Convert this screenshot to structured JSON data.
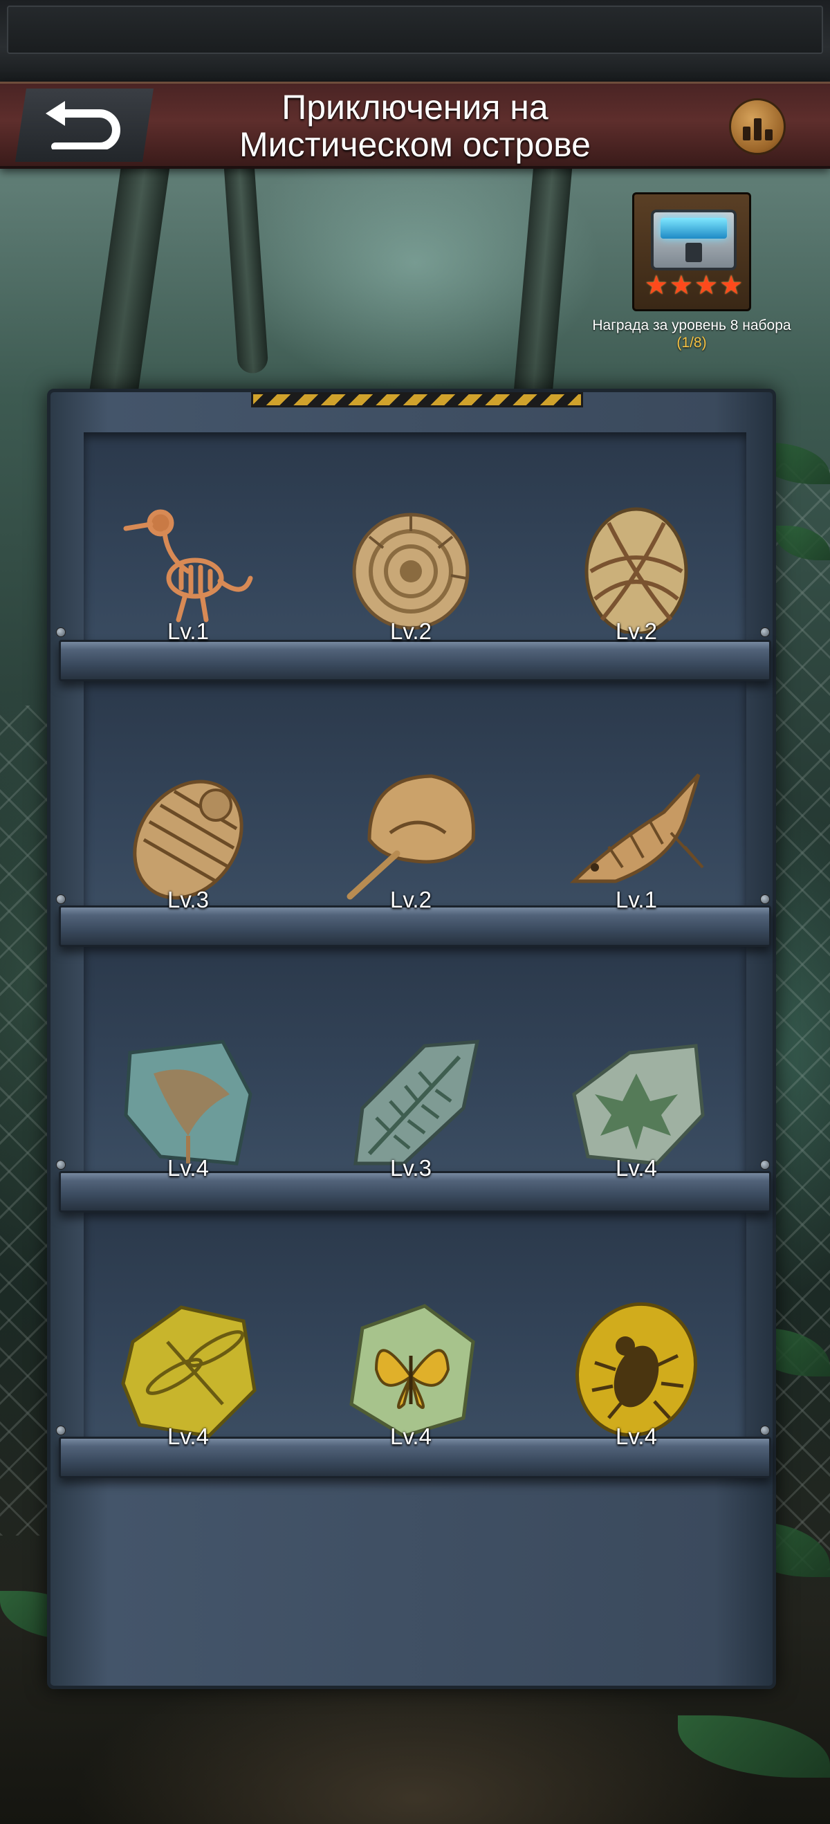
{
  "header": {
    "title_line1": "Приключения на",
    "title_line2": "Мистическом острове",
    "back_icon": "back-arrow-icon",
    "stats_icon": "bar-chart-icon"
  },
  "reward": {
    "label": "Награда за уровень 8 набора",
    "progress": "(1/8)",
    "stars": 4,
    "icon": "treasure-chest-icon"
  },
  "shelves": [
    {
      "items": [
        {
          "name": "bird-skeleton-fossil",
          "level": "Lv.1"
        },
        {
          "name": "ammonite-fossil",
          "level": "Lv.2"
        },
        {
          "name": "fossil-egg",
          "level": "Lv.2"
        }
      ]
    },
    {
      "items": [
        {
          "name": "trilobite-fossil",
          "level": "Lv.3"
        },
        {
          "name": "horseshoe-crab-fossil",
          "level": "Lv.2"
        },
        {
          "name": "fish-fossil",
          "level": "Lv.1"
        }
      ]
    },
    {
      "items": [
        {
          "name": "ginkgo-leaf-fossil",
          "level": "Lv.4"
        },
        {
          "name": "fern-fossil",
          "level": "Lv.3"
        },
        {
          "name": "maple-leaf-fossil",
          "level": "Lv.4"
        }
      ]
    },
    {
      "items": [
        {
          "name": "dragonfly-amber",
          "level": "Lv.4"
        },
        {
          "name": "butterfly-amber",
          "level": "Lv.4"
        },
        {
          "name": "beetle-amber",
          "level": "Lv.4"
        }
      ]
    }
  ],
  "colors": {
    "header": "#5e2e2c",
    "star": "#ff4a1c",
    "progress": "#f6c344",
    "shelf": "#3b4a5d"
  }
}
